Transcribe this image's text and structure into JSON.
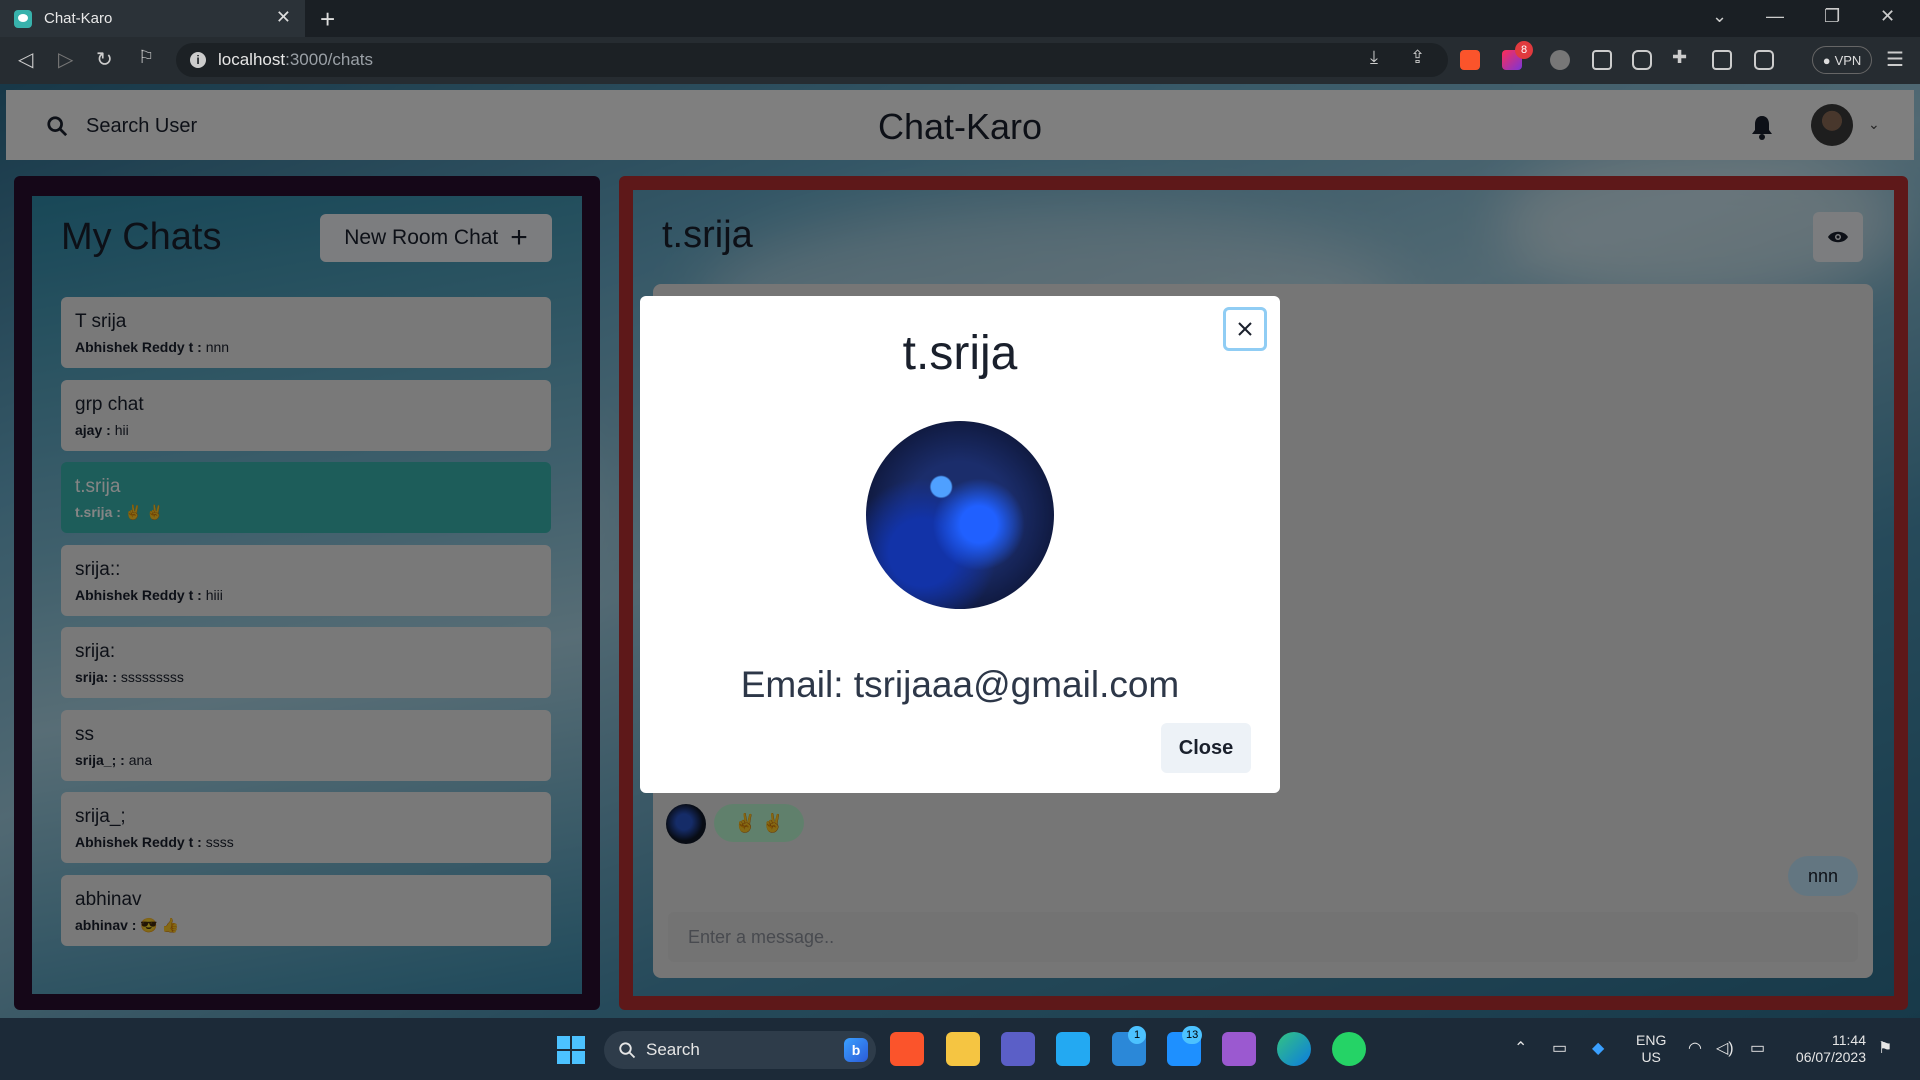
{
  "browser": {
    "tab_title": "Chat-Karo",
    "url_host": "localhost",
    "url_path": ":3000/chats",
    "vpn_label": "VPN",
    "brave_badge": "8"
  },
  "header": {
    "search_label": "Search User",
    "app_title": "Chat-Karo"
  },
  "sidebar": {
    "title": "My Chats",
    "new_room_label": "New Room Chat",
    "chats": [
      {
        "name": "T srija",
        "sender": "Abhishek Reddy t :",
        "message": "nnn",
        "active": false
      },
      {
        "name": "grp chat",
        "sender": "ajay :",
        "message": "hii",
        "active": false
      },
      {
        "name": "t.srija",
        "sender": "t.srija :",
        "message": "✌ ✌",
        "active": true
      },
      {
        "name": "srija::",
        "sender": "Abhishek Reddy t :",
        "message": "hiii",
        "active": false
      },
      {
        "name": "srija:",
        "sender": "srija: :",
        "message": "sssssssss",
        "active": false
      },
      {
        "name": "ss",
        "sender": "srija_; :",
        "message": "ana",
        "active": false
      },
      {
        "name": "srija_;",
        "sender": "Abhishek Reddy t :",
        "message": "ssss",
        "active": false
      },
      {
        "name": "abhinav",
        "sender": "abhinav :",
        "message": "😎 👍",
        "active": false
      }
    ]
  },
  "chat": {
    "name": "t.srija",
    "incoming_message": "✌ ✌",
    "outgoing_message": "nnn",
    "input_placeholder": "Enter a message.."
  },
  "modal": {
    "title": "t.srija",
    "email_text": "Email: tsrijaaa@gmail.com",
    "close_label": "Close"
  },
  "taskbar": {
    "search_label": "Search",
    "teams_badge": "1",
    "mail_badge": "13",
    "lang_line1": "ENG",
    "lang_line2": "US",
    "time": "11:44",
    "date": "06/07/2023"
  },
  "colors": {
    "accent_teal": "#38b2ac",
    "left_frame": "#2a0f2e",
    "right_frame": "#b52e31"
  }
}
